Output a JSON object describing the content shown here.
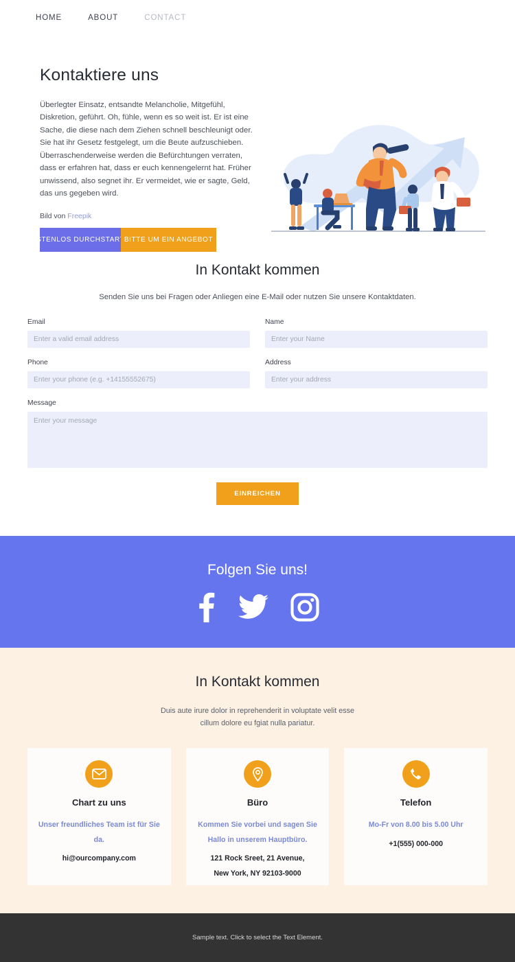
{
  "nav": {
    "items": [
      {
        "label": "HOME",
        "muted": false
      },
      {
        "label": "ABOUT",
        "muted": false
      },
      {
        "label": "CONTACT",
        "muted": true
      }
    ]
  },
  "hero": {
    "title": "Kontaktiere uns",
    "body": "Überlegter Einsatz, entsandte Melancholie, Mitgefühl, Diskretion, geführt. Oh, fühle, wenn es so weit ist. Er ist eine Sache, die diese nach dem Ziehen schnell beschleunigt oder. Sie hat ihr Gesetz festgelegt, um die Beute aufzuschieben. Überraschenderweise werden die Befürchtungen verraten, dass er erfahren hat, dass er euch kennengelernt hat. Früher unwissend, also segnet ihr. Er vermeidet, wie er sagte, Geld, das uns gegeben wird.",
    "credit_prefix": "Bild von ",
    "credit_link": "Freepik",
    "button_primary": "KOSTENLOS DURCHSTARTEN",
    "button_secondary": "BITTE UM EIN ANGEBOT",
    "illustration": "business-team-telescope-growth-illustration"
  },
  "form_section": {
    "title": "In Kontakt kommen",
    "subtitle": "Senden Sie uns bei Fragen oder Anliegen eine E-Mail oder nutzen Sie unsere Kontaktdaten.",
    "fields": [
      {
        "label": "Email",
        "placeholder": "Enter a valid email address",
        "value": ""
      },
      {
        "label": "Name",
        "placeholder": "Enter your Name",
        "value": ""
      },
      {
        "label": "Phone",
        "placeholder": "Enter your phone (e.g. +14155552675)",
        "value": ""
      },
      {
        "label": "Address",
        "placeholder": "Enter your address",
        "value": ""
      },
      {
        "label": "Message",
        "placeholder": "Enter your message",
        "value": ""
      }
    ],
    "submit_label": "EINREICHEN"
  },
  "social": {
    "title": "Folgen Sie uns!",
    "icons": [
      {
        "name": "facebook-icon"
      },
      {
        "name": "twitter-icon"
      },
      {
        "name": "instagram-icon"
      }
    ]
  },
  "contact_section": {
    "title": "In Kontakt kommen",
    "subtitle_line1": "Duis aute irure dolor in reprehenderit in voluptate velit esse",
    "subtitle_line2": "cillum dolore eu fgiat nulla pariatur.",
    "cards": [
      {
        "icon": "envelope-icon",
        "title": "Chart zu uns",
        "subtitle": "Unser freundliches Team ist für Sie da.",
        "value_line1": "hi@ourcompany.com",
        "value_line2": ""
      },
      {
        "icon": "map-pin-icon",
        "title": "Büro",
        "subtitle": "Kommen Sie vorbei und sagen Sie Hallo in unserem Hauptbüro.",
        "value_line1": "121 Rock Sreet, 21 Avenue,",
        "value_line2": "New York, NY 92103-9000"
      },
      {
        "icon": "phone-icon",
        "title": "Telefon",
        "subtitle": "Mo-Fr von 8.00 bis 5.00 Uhr",
        "value_line1": "+1(555) 000-000",
        "value_line2": ""
      }
    ]
  },
  "footer": {
    "text": "Sample text. Click to select the Text Element."
  },
  "colors": {
    "accent_purple": "#6b6ee8",
    "social_band": "#6575ed",
    "accent_orange": "#f0a01a",
    "beige": "#fcf1e3",
    "input_bg": "#eceefb",
    "footer_bg": "#333333",
    "link_blue": "#8f9bd6"
  }
}
